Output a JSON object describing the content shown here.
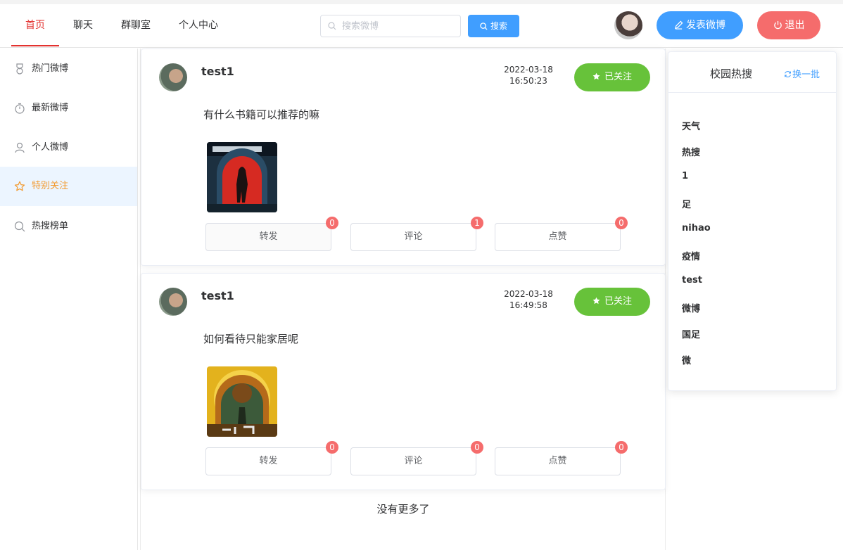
{
  "nav": {
    "items": [
      {
        "label": "首页",
        "active": true
      },
      {
        "label": "聊天",
        "active": false
      },
      {
        "label": "群聊室",
        "active": false
      },
      {
        "label": "个人中心",
        "active": false
      }
    ],
    "search_placeholder": "搜索微博",
    "search_button": "搜索",
    "post_button": "发表微博",
    "logout_button": "退出"
  },
  "sidebar": {
    "items": [
      {
        "label": "热门微博",
        "icon": "medal-icon"
      },
      {
        "label": "最新微博",
        "icon": "stopwatch-icon"
      },
      {
        "label": "个人微博",
        "icon": "user-icon"
      },
      {
        "label": "特别关注",
        "icon": "star-icon",
        "active": true
      },
      {
        "label": "热搜榜单",
        "icon": "search-icon"
      }
    ]
  },
  "posts": [
    {
      "user": "test1",
      "date": "2022-03-18",
      "time": "16:50:23",
      "follow_label": "已关注",
      "text": "有什么书籍可以推荐的嘛",
      "image": "book-cover-red-icon",
      "actions": [
        {
          "label": "转发",
          "count": "0"
        },
        {
          "label": "评论",
          "count": "1"
        },
        {
          "label": "点赞",
          "count": "0"
        }
      ]
    },
    {
      "user": "test1",
      "date": "2022-03-18",
      "time": "16:49:58",
      "follow_label": "已关注",
      "text": "如何看待只能家居呢",
      "image": "book-cover-yellow-icon",
      "actions": [
        {
          "label": "转发",
          "count": "0"
        },
        {
          "label": "评论",
          "count": "0"
        },
        {
          "label": "点赞",
          "count": "0"
        }
      ]
    }
  ],
  "feed_end": "没有更多了",
  "hot": {
    "title": "校园热搜",
    "refresh": "换一批",
    "items": [
      "天气",
      "热搜",
      "1",
      "足",
      "nihao",
      "疫情",
      "test",
      "微博",
      "国足",
      "微"
    ]
  },
  "colors": {
    "primary": "#409eff",
    "success": "#67c23a",
    "danger": "#f56c6c",
    "nav_active": "#e3322f",
    "sidebar_active": "#f29a2f"
  }
}
